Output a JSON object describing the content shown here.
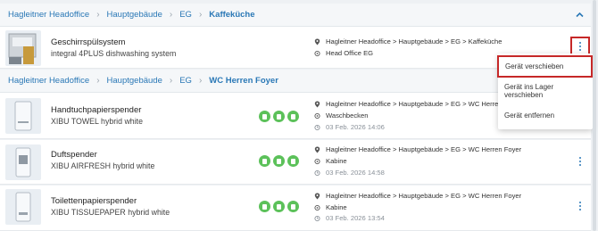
{
  "groups": [
    {
      "breadcrumb": [
        "Hagleitner Headoffice",
        "Hauptgebäude",
        "EG",
        "Kaffeküche"
      ],
      "collapse_icon": "chevron-up-icon"
    },
    {
      "breadcrumb": [
        "Hagleitner Headoffice",
        "Hauptgebäude",
        "EG",
        "WC Herren Foyer"
      ]
    }
  ],
  "devices": [
    {
      "name": "Geschirrspülsystem",
      "model": "integral 4PLUS dishwashing system",
      "path": "Hagleitner Headoffice > Hauptgebäude > EG > Kaffeküche",
      "location": "Head Office EG"
    },
    {
      "name": "Handtuchpapierspender",
      "model": "XIBU TOWEL hybrid white",
      "path": "Hagleitner Headoffice > Hauptgebäude > EG > WC Herren Foyer",
      "location": "Waschbecken",
      "date": "03 Feb. 2026 14:06"
    },
    {
      "name": "Duftspender",
      "model": "XIBU AIRFRESH hybrid white",
      "path": "Hagleitner Headoffice > Hauptgebäude > EG > WC Herren Foyer",
      "location": "Kabine",
      "date": "03 Feb. 2026 14:58"
    },
    {
      "name": "Toilettenpapierspender",
      "model": "XIBU TISSUEPAPER hybrid white",
      "path": "Hagleitner Headoffice > Hauptgebäude > EG > WC Herren Foyer",
      "location": "Kabine",
      "date": "03 Feb. 2026 13:54"
    }
  ],
  "context_menu": {
    "items": [
      "Gerät verschieben",
      "Gerät ins Lager verschieben",
      "Gerät entfernen"
    ],
    "highlighted": "Gerät verschieben"
  },
  "colors": {
    "link": "#2a78b6",
    "status_green": "#5cc15a",
    "highlight_red": "#c62828"
  }
}
